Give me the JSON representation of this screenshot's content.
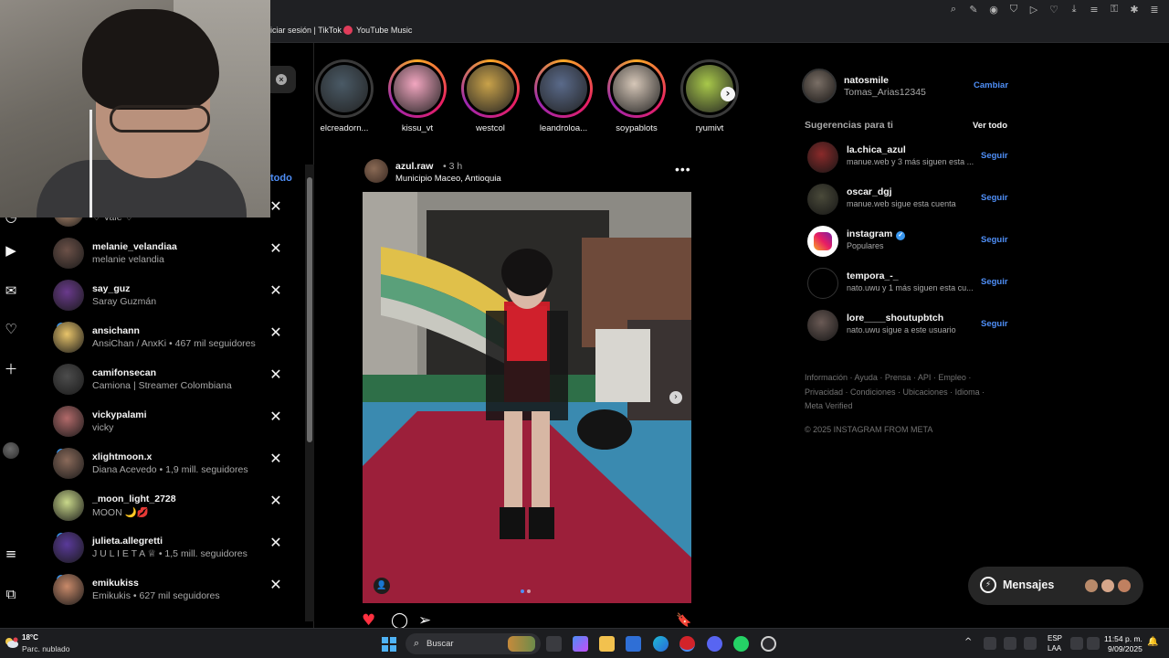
{
  "bookmarks": {
    "tiktok_label": "iciar sesión | TikTok",
    "youtube_label": "YouTube Music"
  },
  "search": {
    "clear_icon": "×",
    "clear_all_label": "todo",
    "results": [
      {
        "username": "",
        "subtitle": "♡ Vale ♡",
        "verified": false,
        "color": "#c79a7a"
      },
      {
        "username": "melanie_velandiaa",
        "subtitle": "melanie velandia",
        "verified": false,
        "color": "#6c5148"
      },
      {
        "username": "say_guz",
        "subtitle": "Saray Guzmán",
        "verified": false,
        "color": "#6a3a8c"
      },
      {
        "username": "ansichann",
        "subtitle": "AnsiChan / AnxKi • 467 mil seguidores",
        "verified": true,
        "color": "#e8c46a"
      },
      {
        "username": "camifonsecan",
        "subtitle": "Camiona | Streamer Colombiana",
        "verified": false,
        "color": "#4d4d4d"
      },
      {
        "username": "vickypalami",
        "subtitle": "vicky",
        "verified": false,
        "color": "#b26a6a"
      },
      {
        "username": "xlightmoon.x",
        "subtitle": "Diana Acevedo • 1,9 mill. seguidores",
        "verified": true,
        "color": "#8a6a5a"
      },
      {
        "username": "_moon_light_2728",
        "subtitle": "MOON 🌙💋",
        "verified": false,
        "color": "#c9d88a"
      },
      {
        "username": "julieta.allegretti",
        "subtitle": "J U L I E T A ♕ • 1,5 mill. seguidores",
        "verified": true,
        "color": "#5a3a9a"
      },
      {
        "username": "emikukiss",
        "subtitle": "Emikukis • 627 mil seguidores",
        "verified": true,
        "color": "#c98a6a"
      }
    ]
  },
  "stories": [
    {
      "name": "elcreadorn...",
      "color": "#4a5a66",
      "seen": true
    },
    {
      "name": "kissu_vt",
      "color": "#f2a6c0",
      "seen": false
    },
    {
      "name": "westcol",
      "color": "#c9a24a",
      "seen": false
    },
    {
      "name": "leandroloa...",
      "color": "#5a6a8a",
      "seen": false
    },
    {
      "name": "soypablots",
      "color": "#d6c7b8",
      "seen": false
    },
    {
      "name": "ryumivt",
      "color": "#a8c84a",
      "seen": true
    }
  ],
  "stories_next_icon": "›",
  "post": {
    "username": "azul.raw",
    "time": "• 3 h",
    "location": "Municipio Maceo, Antioquia",
    "more_icon": "•••",
    "next_icon": "›",
    "tag_icon": "👤",
    "image_count": 2,
    "current_image": 1,
    "actions": {
      "like": "♥",
      "comment": "◯",
      "share": "➢",
      "save": "🔖"
    }
  },
  "account": {
    "username": "natosmile",
    "name": "Tomas_Arias12345",
    "switch_label": "Cambiar"
  },
  "suggestions": {
    "title": "Sugerencias para ti",
    "see_all_label": "Ver todo",
    "follow_label": "Seguir",
    "items": [
      {
        "username": "la.chica_azul",
        "subtitle": "manue.web y 3 más siguen esta ...",
        "verified": false,
        "color": "#8a2a2a"
      },
      {
        "username": "oscar_dgj",
        "subtitle": "manue.web sigue esta cuenta",
        "verified": false,
        "color": "#4a4a3a"
      },
      {
        "username": "instagram",
        "subtitle": "Populares",
        "verified": true,
        "color": "#ffffff"
      },
      {
        "username": "tempora_-_",
        "subtitle": "nato.uwu y 1 más siguen esta cu...",
        "verified": false,
        "color": "#000000"
      },
      {
        "username": "lore____shoutupbtch",
        "subtitle": "nato.uwu sigue a este usuario",
        "verified": false,
        "color": "#6a5a55"
      }
    ]
  },
  "footer": {
    "links": "Información · Ayuda · Prensa · API · Empleo · Privacidad · Condiciones · Ubicaciones · Idioma · Meta Verified",
    "copyright": "© 2025 INSTAGRAM FROM META"
  },
  "messages": {
    "label": "Mensajes",
    "icon": "⚡"
  },
  "taskbar": {
    "temperature": "18°C",
    "weather": "Parc. nublado",
    "search_placeholder": "Buscar",
    "search_icon": "⌕",
    "tray": "^",
    "lang_top": "ESP",
    "lang_bottom": "LAA",
    "time": "11:54 p. m.",
    "date": "9/09/2025",
    "bell_icon": "🔔"
  },
  "nav_icons": {
    "reels": "▶",
    "messenger": "✉",
    "notifications": "♡",
    "create": "＋",
    "more": "≡",
    "threads": "⧉",
    "explore": "◷"
  },
  "colors": {
    "accent": "#4f8ff7",
    "verified": "#3897f0",
    "like": "#ff3040",
    "background": "#000000"
  }
}
